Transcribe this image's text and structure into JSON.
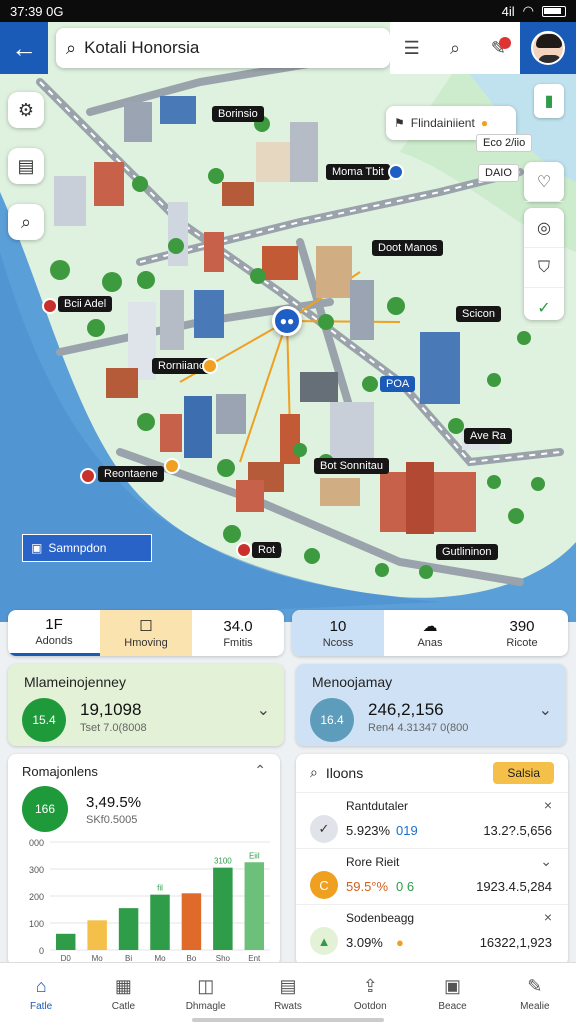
{
  "status": {
    "time": "37:39",
    "left_extra": "0G",
    "right_text": "4il"
  },
  "search": {
    "value": "Kotali Honorsia"
  },
  "map": {
    "notification": {
      "text": "Flindainiient"
    },
    "eco_chip": "Eco 2/iio",
    "label_dario": "DAIO",
    "labels": [
      {
        "text": "Borinsio"
      },
      {
        "text": "Moma Tbit"
      },
      {
        "text": "Doot Manos"
      },
      {
        "text": "Scicon"
      },
      {
        "text": "Bcii Adel"
      },
      {
        "text": "Rorniiano"
      },
      {
        "text": "Reontaene"
      },
      {
        "text": "Bot Sonnitau"
      },
      {
        "text": "Rot"
      },
      {
        "text": "Gutlininon"
      },
      {
        "text": "POA"
      },
      {
        "text": "Ave Ra"
      }
    ],
    "legend": "Samnpdon"
  },
  "tabs_left": [
    {
      "value": "1F",
      "label": "Adonds"
    },
    {
      "value": "",
      "label": "Hmoving"
    },
    {
      "value": "34.0",
      "label": "Fmitis"
    }
  ],
  "tabs_right": [
    {
      "value": "10",
      "label": "Ncoss"
    },
    {
      "value": "",
      "label": "Anas"
    },
    {
      "value": "390",
      "label": "Ricote"
    }
  ],
  "stat_left": {
    "title": "Mlameinojenney",
    "badge": "15.4",
    "big": "19,1098",
    "sub": "Tset 7.0(8008"
  },
  "stat_right": {
    "title": "Menoojamay",
    "badge": "16.4",
    "big": "246,2,156",
    "sub": "Ren4 4.31347 0(800"
  },
  "chart_panel": {
    "title": "Romajonlens",
    "badge": "166",
    "big": "3,49.5%",
    "sub": "SKf0.5005"
  },
  "chart_data": {
    "type": "bar",
    "categories": [
      "D0",
      "Mo",
      "Bi",
      "Mo",
      "Bo",
      "Sho",
      "Ent"
    ],
    "values": [
      60,
      110,
      155,
      205,
      210,
      305,
      325
    ],
    "value_labels": [
      "",
      "",
      "",
      "fil",
      "",
      "3100",
      "Eiil"
    ],
    "ylim": [
      0,
      400
    ],
    "yticks": [
      "0",
      "100",
      "200",
      "300",
      "400"
    ],
    "ytick_labels": [
      "0",
      "100",
      "200",
      "300",
      "000"
    ],
    "colors": [
      "#2e9c48",
      "#f5c04a",
      "#2e9c48",
      "#2e9c48",
      "#e06a2a",
      "#2e9c48",
      "#6cc07a"
    ]
  },
  "list_panel": {
    "title": "Iloons",
    "button": "Salsia",
    "items": [
      {
        "name": "Rantdutaler",
        "pct": "5.923%",
        "pct2": "019",
        "amount": "13.2?.5,656"
      },
      {
        "name": "Rore Rieit",
        "pct": "59.5°%",
        "pct2": "0 6",
        "amount": "1923.4.5,284"
      },
      {
        "name": "Sodenbeagg",
        "pct": "3.09%",
        "pct2": "",
        "amount": "16322,1,923"
      }
    ]
  },
  "bottom_nav": [
    {
      "label": "Fatle",
      "icon": "home-icon"
    },
    {
      "label": "Catle",
      "icon": "calendar-icon"
    },
    {
      "label": "Dhmagle",
      "icon": "bag-icon"
    },
    {
      "label": "Rwats",
      "icon": "document-icon"
    },
    {
      "label": "Ootdon",
      "icon": "share-icon"
    },
    {
      "label": "Beace",
      "icon": "briefcase-icon"
    },
    {
      "label": "Mealie",
      "icon": "pen-icon"
    }
  ]
}
